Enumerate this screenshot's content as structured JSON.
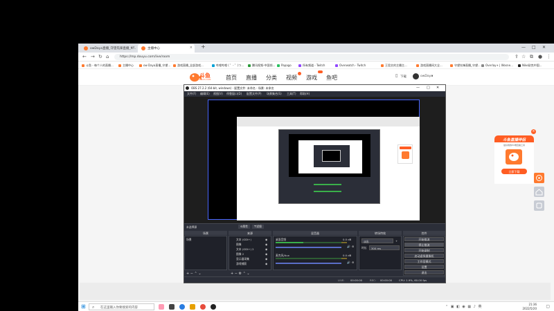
{
  "browser": {
    "tabs": [
      {
        "label": "owDaya直播_守望先锋直播_ft...",
        "fav_color": "#ff7a2f"
      },
      {
        "label": "主播中心",
        "fav_color": "#ff7a2f"
      }
    ],
    "new_tab": "+",
    "url": "https://mp.douyu.com/live/room",
    "bookmarks": [
      {
        "label": "斗鱼 - 每个人的直播...",
        "color": "#ff7a2f"
      },
      {
        "label": "主播中心",
        "color": "#ff7a2f"
      },
      {
        "label": "ow Daya直播_守望...",
        "color": "#ff7a2f"
      },
      {
        "label": "游戏直播_全部游戏...",
        "color": "#ff7a2f"
      },
      {
        "label": "哔哩哔哩 ( ゜- ゜)つ...",
        "color": "#00a1d6"
      },
      {
        "label": "腾讯视频-中国领...",
        "color": "#2c9b3b"
      },
      {
        "label": "Papago",
        "color": "#29c060"
      },
      {
        "label": "所有频道 - Twitch",
        "color": "#9146ff"
      },
      {
        "label": "Overwatch - Twitch",
        "color": "#9146ff"
      },
      {
        "label": "王思文的主播主...",
        "color": "#ff7a2f"
      },
      {
        "label": "游戏直播间大全...",
        "color": "#ff7a2f"
      },
      {
        "label": "守望先锋直播_守望...",
        "color": "#ff7a2f"
      },
      {
        "label": "Overlay+ | Wosne...",
        "color": "#888888"
      },
      {
        "label": "Nike耐克中国...",
        "color": "#222222"
      }
    ]
  },
  "site": {
    "logo_text": "斗鱼",
    "logo_sub": "DOUYU.COM",
    "nav": [
      {
        "label": "首页"
      },
      {
        "label": "直播"
      },
      {
        "label": "分类"
      },
      {
        "label": "视频"
      },
      {
        "label": "游戏"
      },
      {
        "label": "鱼吧"
      }
    ],
    "download": "下载",
    "username": "owDaya"
  },
  "obs": {
    "title": "OBS 27.2.2 (64-bit, windows) - 配置文件: 未命名 - 场景: 未命名",
    "menu": [
      "文件(F)",
      "编辑(E)",
      "视图(V)",
      "停靠窗口(D)",
      "配置文件(P)",
      "场景集合(S)",
      "工具(T)",
      "帮助(H)"
    ],
    "source_bar_label": "未选择源",
    "source_bar_buttons": [
      "属性",
      "滤镜"
    ],
    "docks": {
      "scenes": "场景",
      "sources": "来源",
      "mixer": "混音器",
      "transitions": "转场特效",
      "controls": "控件"
    },
    "scene_item": "场景",
    "sources": [
      "文本 (GDI+)",
      "图像",
      "文本 (GDI+) 2",
      "图像 2",
      "显示器采集",
      "游戏捕获"
    ],
    "mixer": [
      {
        "name": "桌面音频",
        "db": "0.0 dB"
      },
      {
        "name": "麦克风/Aux",
        "db": "0.0 dB"
      }
    ],
    "transition_type": "淡出",
    "transition_duration_label": "时长",
    "transition_duration": "300 ms",
    "controls": [
      "开始推流",
      "停止推流",
      "开始录制",
      "启动虚拟摄像机",
      "工作室模式",
      "设置",
      "退出"
    ],
    "status": {
      "live_label": "LIVE:",
      "live_time": "00:00:00",
      "rec_label": "REC:",
      "rec_time": "00:00:00",
      "cpu": "CPU: 1.9%, 60.00 fps"
    }
  },
  "promo": {
    "title": "斗鱼直播伴侣",
    "desc": "最好用的PC端直播工具",
    "button": "立即下载"
  },
  "taskbar": {
    "search_placeholder": "在这里输入你要搜索的内容",
    "time": "21:36",
    "date": "2022/5/20"
  },
  "colors": {
    "brand": "#ff5d23",
    "obs_bg": "#2b2e38",
    "obs_accent": "#4a67ff"
  }
}
